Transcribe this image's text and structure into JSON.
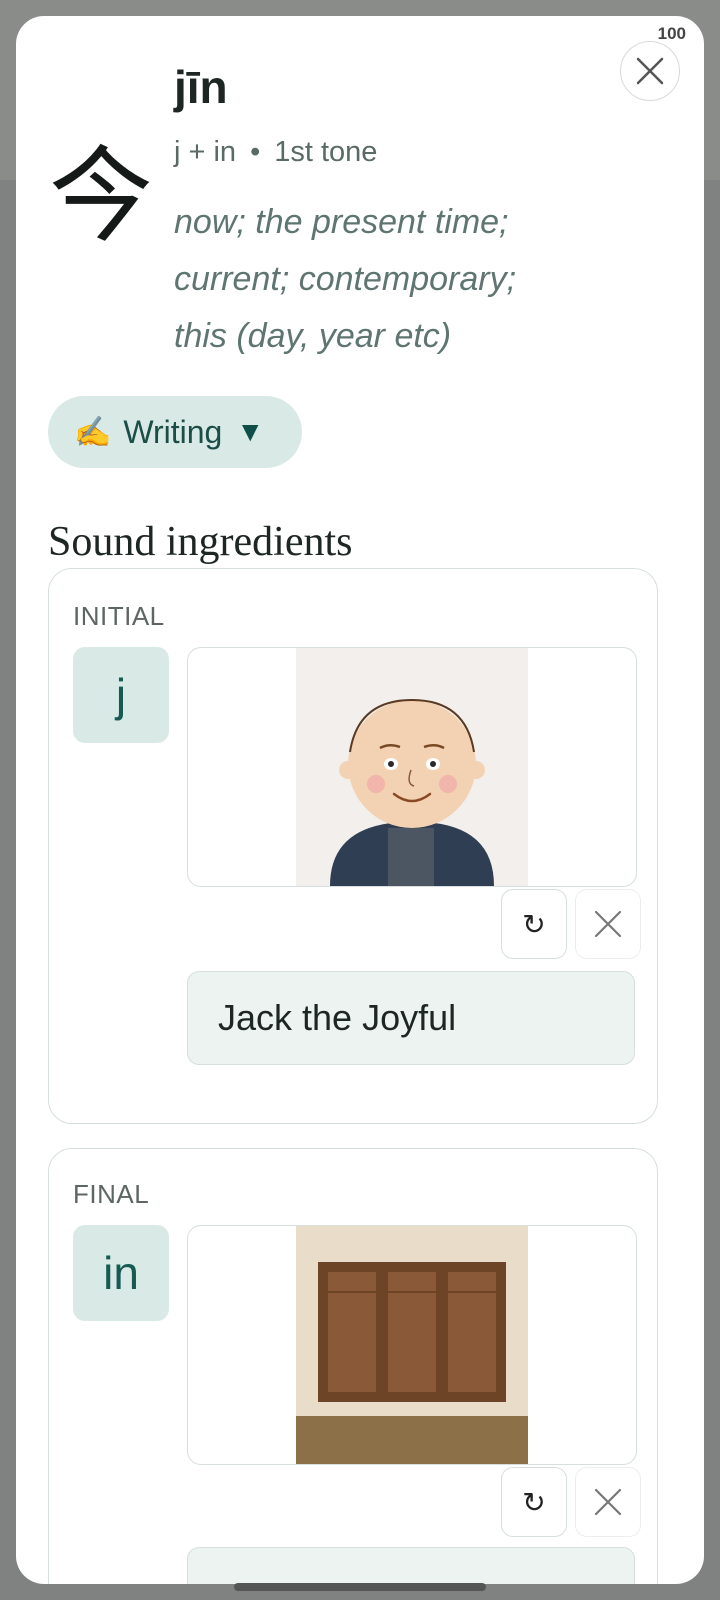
{
  "header": {
    "counter": "100",
    "character": "今",
    "pinyin": "jīn",
    "breakdown": "j + in",
    "separator": "•",
    "tone": "1st tone",
    "meaning_lines": [
      "now; the present time;",
      "current; contemporary;",
      "this (day, year etc)"
    ]
  },
  "writing_toggle": {
    "emoji": "✍️",
    "label": "Writing",
    "arrow": "▼"
  },
  "sound_ingredients": {
    "title": "Sound ingredients",
    "initial": {
      "label": "INITIAL",
      "sound": "j",
      "name": "Jack the Joyful",
      "image_icon": "bald-man-illustration"
    },
    "final": {
      "label": "FINAL",
      "sound": "in",
      "image_icon": "wooden-cabinet-illustration"
    },
    "refresh_icon": "↻",
    "remove_icon": "close-icon"
  }
}
